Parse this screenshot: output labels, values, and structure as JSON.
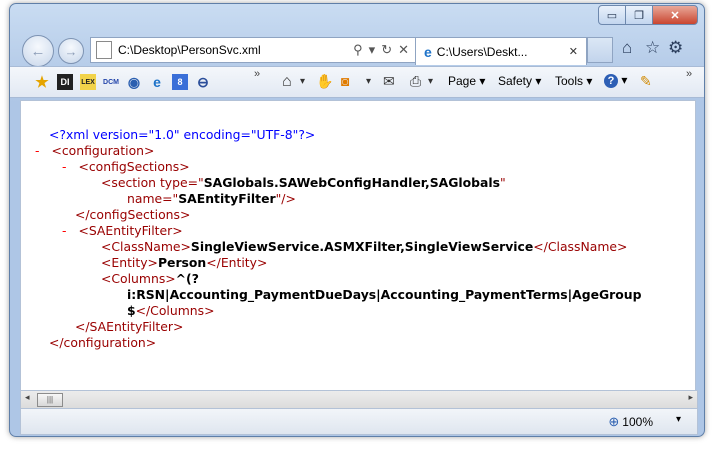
{
  "window": {
    "minimize": "▭",
    "restore": "❐",
    "close": "✕"
  },
  "nav": {
    "back_glyph": "←",
    "forward_glyph": "→",
    "address": "C:\\Desktop\\PersonSvc.xml",
    "search_glyph": "⚲",
    "dropdown_glyph": "▾",
    "refresh_glyph": "↻",
    "stop_glyph": "✕"
  },
  "tab": {
    "label": "C:\\Users\\Deskt...",
    "close_glyph": "✕"
  },
  "right_icons": {
    "home": "⌂",
    "favorites": "☆",
    "tools": "⚙"
  },
  "favorites_bar": {
    "star": "★",
    "items": [
      "DI",
      "LEX",
      "DCM",
      "◉",
      "e",
      "8",
      "⊖"
    ],
    "overflow": "»"
  },
  "command_bar": {
    "home": "⌂",
    "hand": "✋",
    "feeds": "◙",
    "mail": "✉",
    "print": "⎙",
    "page": "Page",
    "safety": "Safety",
    "tools": "Tools",
    "help": "?",
    "dd": "▾",
    "overflow": "»"
  },
  "xml": {
    "decl": "<?xml version=\"1.0\" encoding=\"UTF-8\"?>",
    "minus": "-",
    "configuration_open": "<configuration>",
    "configSections_open": "<configSections>",
    "section_open": "<section type=\"",
    "section_type": "SAGlobals.SAWebConfigHandler,SAGlobals",
    "quote": "\"",
    "name_attr": "name=\"",
    "name_value": "SAEntityFilter",
    "selfclose": "\"/>",
    "configSections_close": "</configSections>",
    "saentity_open": "<SAEntityFilter>",
    "classname_open": "<ClassName>",
    "classname_value": "SingleViewService.ASMXFilter,SingleViewService",
    "classname_close": "</ClassName>",
    "entity_open": "<Entity>",
    "entity_value": "Person",
    "entity_close": "</Entity>",
    "columns_open": "<Columns>",
    "columns_value_1": "^(?",
    "columns_value_2": "i:RSN|Accounting_PaymentDueDays|Accounting_PaymentTerms|AgeGroup",
    "columns_value_3": "$",
    "columns_close": "</Columns>",
    "saentity_close": "</SAEntityFilter>",
    "configuration_close": "</configuration>"
  },
  "scrollbar": {
    "left": "◂",
    "right": "▸",
    "grip": "|||"
  },
  "status": {
    "zoom_icon": "⊕",
    "zoom": "100%",
    "dd": "▾"
  }
}
